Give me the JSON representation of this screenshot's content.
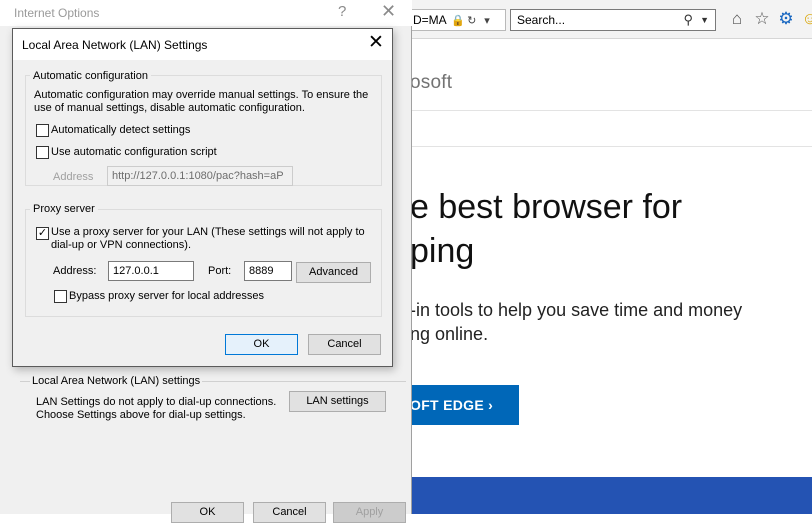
{
  "browser": {
    "address_fragment": "D=MA",
    "search_placeholder": "Search...",
    "ms_logo_text": "osoft",
    "hero_line1": "e best browser for",
    "hero_line2": "ping",
    "sub_line1": "-in tools to help you save time and money",
    "sub_line2": "ng online.",
    "cta_label": "OFT EDGE ›"
  },
  "internet_options": {
    "title": "Internet Options",
    "help_glyph": "?",
    "close_glyph": "✕",
    "lan_group_label": "Local Area Network (LAN) settings",
    "lan_desc_line1": "LAN Settings do not apply to dial-up connections.",
    "lan_desc_line2": "Choose Settings above for dial-up settings.",
    "lan_settings_button": "LAN settings",
    "ok_button": "OK",
    "cancel_button": "Cancel",
    "apply_button": "Apply"
  },
  "lan_dialog": {
    "title": "Local Area Network (LAN) Settings",
    "close_glyph": "✕",
    "auto_config": {
      "group_label": "Automatic configuration",
      "desc_line1": "Automatic configuration may override manual settings.  To ensure the",
      "desc_line2": "use of manual settings, disable automatic configuration.",
      "auto_detect_label": "Automatically detect settings",
      "auto_detect_checked": false,
      "script_label": "Use automatic configuration script",
      "script_checked": false,
      "address_label": "Address",
      "address_value": "http://127.0.0.1:1080/pac?hash=aP"
    },
    "proxy": {
      "group_label": "Proxy server",
      "use_proxy_line1": "Use a proxy server for your LAN (These settings will not apply to",
      "use_proxy_line2": "dial-up or VPN connections).",
      "use_proxy_checked": true,
      "address_label": "Address:",
      "address_value": "127.0.0.1",
      "port_label": "Port:",
      "port_value": "8889",
      "advanced_button": "Advanced",
      "bypass_label": "Bypass proxy server for local addresses",
      "bypass_checked": false
    },
    "ok_button": "OK",
    "cancel_button": "Cancel"
  },
  "colors": {
    "cta_blue": "#0067b8",
    "band_blue": "#2453b3",
    "default_button_border": "#0078d7"
  }
}
